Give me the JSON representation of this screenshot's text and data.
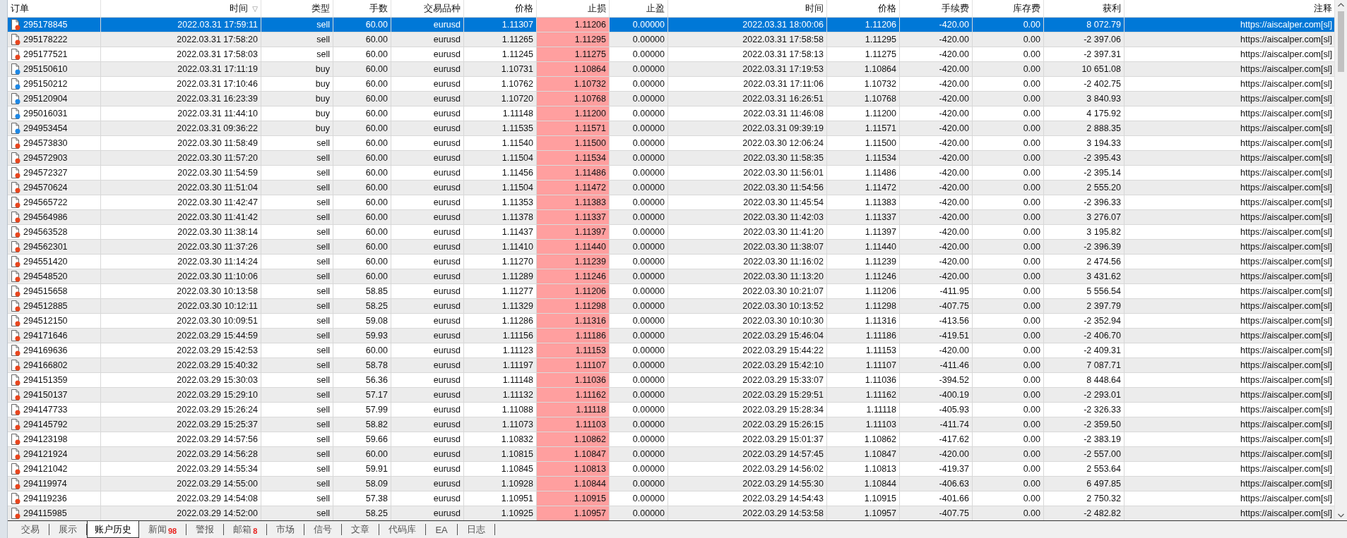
{
  "table": {
    "columns": [
      {
        "label": "订单"
      },
      {
        "label": "时间",
        "sort": "▽"
      },
      {
        "label": "类型"
      },
      {
        "label": "手数"
      },
      {
        "label": "交易品种"
      },
      {
        "label": "价格"
      },
      {
        "label": "止损"
      },
      {
        "label": "止盈"
      },
      {
        "label": "时间"
      },
      {
        "label": "价格"
      },
      {
        "label": "手续费"
      },
      {
        "label": "库存费"
      },
      {
        "label": "获利"
      },
      {
        "label": "注释"
      }
    ],
    "rows": [
      {
        "kind": "sell",
        "selected": true,
        "cells": [
          "295178845",
          "2022.03.31 17:59:11",
          "sell",
          "60.00",
          "eurusd",
          "1.11307",
          "1.11206",
          "0.00000",
          "2022.03.31 18:00:06",
          "1.11206",
          "-420.00",
          "0.00",
          "8 072.79",
          "https://aiscalper.com[sl]"
        ]
      },
      {
        "kind": "sell",
        "selected": false,
        "cells": [
          "295178222",
          "2022.03.31 17:58:20",
          "sell",
          "60.00",
          "eurusd",
          "1.11265",
          "1.11295",
          "0.00000",
          "2022.03.31 17:58:58",
          "1.11295",
          "-420.00",
          "0.00",
          "-2 397.06",
          "https://aiscalper.com[sl]"
        ]
      },
      {
        "kind": "sell",
        "selected": false,
        "cells": [
          "295177521",
          "2022.03.31 17:58:03",
          "sell",
          "60.00",
          "eurusd",
          "1.11245",
          "1.11275",
          "0.00000",
          "2022.03.31 17:58:13",
          "1.11275",
          "-420.00",
          "0.00",
          "-2 397.31",
          "https://aiscalper.com[sl]"
        ]
      },
      {
        "kind": "buy",
        "selected": false,
        "cells": [
          "295150610",
          "2022.03.31 17:11:19",
          "buy",
          "60.00",
          "eurusd",
          "1.10731",
          "1.10864",
          "0.00000",
          "2022.03.31 17:19:53",
          "1.10864",
          "-420.00",
          "0.00",
          "10 651.08",
          "https://aiscalper.com[sl]"
        ]
      },
      {
        "kind": "buy",
        "selected": false,
        "cells": [
          "295150212",
          "2022.03.31 17:10:46",
          "buy",
          "60.00",
          "eurusd",
          "1.10762",
          "1.10732",
          "0.00000",
          "2022.03.31 17:11:06",
          "1.10732",
          "-420.00",
          "0.00",
          "-2 402.75",
          "https://aiscalper.com[sl]"
        ]
      },
      {
        "kind": "buy",
        "selected": false,
        "cells": [
          "295120904",
          "2022.03.31 16:23:39",
          "buy",
          "60.00",
          "eurusd",
          "1.10720",
          "1.10768",
          "0.00000",
          "2022.03.31 16:26:51",
          "1.10768",
          "-420.00",
          "0.00",
          "3 840.93",
          "https://aiscalper.com[sl]"
        ]
      },
      {
        "kind": "buy",
        "selected": false,
        "cells": [
          "295016031",
          "2022.03.31 11:44:10",
          "buy",
          "60.00",
          "eurusd",
          "1.11148",
          "1.11200",
          "0.00000",
          "2022.03.31 11:46:08",
          "1.11200",
          "-420.00",
          "0.00",
          "4 175.92",
          "https://aiscalper.com[sl]"
        ]
      },
      {
        "kind": "buy",
        "selected": false,
        "cells": [
          "294953454",
          "2022.03.31 09:36:22",
          "buy",
          "60.00",
          "eurusd",
          "1.11535",
          "1.11571",
          "0.00000",
          "2022.03.31 09:39:19",
          "1.11571",
          "-420.00",
          "0.00",
          "2 888.35",
          "https://aiscalper.com[sl]"
        ]
      },
      {
        "kind": "sell",
        "selected": false,
        "cells": [
          "294573830",
          "2022.03.30 11:58:49",
          "sell",
          "60.00",
          "eurusd",
          "1.11540",
          "1.11500",
          "0.00000",
          "2022.03.30 12:06:24",
          "1.11500",
          "-420.00",
          "0.00",
          "3 194.33",
          "https://aiscalper.com[sl]"
        ]
      },
      {
        "kind": "sell",
        "selected": false,
        "cells": [
          "294572903",
          "2022.03.30 11:57:20",
          "sell",
          "60.00",
          "eurusd",
          "1.11504",
          "1.11534",
          "0.00000",
          "2022.03.30 11:58:35",
          "1.11534",
          "-420.00",
          "0.00",
          "-2 395.43",
          "https://aiscalper.com[sl]"
        ]
      },
      {
        "kind": "sell",
        "selected": false,
        "cells": [
          "294572327",
          "2022.03.30 11:54:59",
          "sell",
          "60.00",
          "eurusd",
          "1.11456",
          "1.11486",
          "0.00000",
          "2022.03.30 11:56:01",
          "1.11486",
          "-420.00",
          "0.00",
          "-2 395.14",
          "https://aiscalper.com[sl]"
        ]
      },
      {
        "kind": "sell",
        "selected": false,
        "cells": [
          "294570624",
          "2022.03.30 11:51:04",
          "sell",
          "60.00",
          "eurusd",
          "1.11504",
          "1.11472",
          "0.00000",
          "2022.03.30 11:54:56",
          "1.11472",
          "-420.00",
          "0.00",
          "2 555.20",
          "https://aiscalper.com[sl]"
        ]
      },
      {
        "kind": "sell",
        "selected": false,
        "cells": [
          "294565722",
          "2022.03.30 11:42:47",
          "sell",
          "60.00",
          "eurusd",
          "1.11353",
          "1.11383",
          "0.00000",
          "2022.03.30 11:45:54",
          "1.11383",
          "-420.00",
          "0.00",
          "-2 396.33",
          "https://aiscalper.com[sl]"
        ]
      },
      {
        "kind": "sell",
        "selected": false,
        "cells": [
          "294564986",
          "2022.03.30 11:41:42",
          "sell",
          "60.00",
          "eurusd",
          "1.11378",
          "1.11337",
          "0.00000",
          "2022.03.30 11:42:03",
          "1.11337",
          "-420.00",
          "0.00",
          "3 276.07",
          "https://aiscalper.com[sl]"
        ]
      },
      {
        "kind": "sell",
        "selected": false,
        "cells": [
          "294563528",
          "2022.03.30 11:38:14",
          "sell",
          "60.00",
          "eurusd",
          "1.11437",
          "1.11397",
          "0.00000",
          "2022.03.30 11:41:20",
          "1.11397",
          "-420.00",
          "0.00",
          "3 195.82",
          "https://aiscalper.com[sl]"
        ]
      },
      {
        "kind": "sell",
        "selected": false,
        "cells": [
          "294562301",
          "2022.03.30 11:37:26",
          "sell",
          "60.00",
          "eurusd",
          "1.11410",
          "1.11440",
          "0.00000",
          "2022.03.30 11:38:07",
          "1.11440",
          "-420.00",
          "0.00",
          "-2 396.39",
          "https://aiscalper.com[sl]"
        ]
      },
      {
        "kind": "sell",
        "selected": false,
        "cells": [
          "294551420",
          "2022.03.30 11:14:24",
          "sell",
          "60.00",
          "eurusd",
          "1.11270",
          "1.11239",
          "0.00000",
          "2022.03.30 11:16:02",
          "1.11239",
          "-420.00",
          "0.00",
          "2 474.56",
          "https://aiscalper.com[sl]"
        ]
      },
      {
        "kind": "sell",
        "selected": false,
        "cells": [
          "294548520",
          "2022.03.30 11:10:06",
          "sell",
          "60.00",
          "eurusd",
          "1.11289",
          "1.11246",
          "0.00000",
          "2022.03.30 11:13:20",
          "1.11246",
          "-420.00",
          "0.00",
          "3 431.62",
          "https://aiscalper.com[sl]"
        ]
      },
      {
        "kind": "sell",
        "selected": false,
        "cells": [
          "294515658",
          "2022.03.30 10:13:58",
          "sell",
          "58.85",
          "eurusd",
          "1.11277",
          "1.11206",
          "0.00000",
          "2022.03.30 10:21:07",
          "1.11206",
          "-411.95",
          "0.00",
          "5 556.54",
          "https://aiscalper.com[sl]"
        ]
      },
      {
        "kind": "sell",
        "selected": false,
        "cells": [
          "294512885",
          "2022.03.30 10:12:11",
          "sell",
          "58.25",
          "eurusd",
          "1.11329",
          "1.11298",
          "0.00000",
          "2022.03.30 10:13:52",
          "1.11298",
          "-407.75",
          "0.00",
          "2 397.79",
          "https://aiscalper.com[sl]"
        ]
      },
      {
        "kind": "sell",
        "selected": false,
        "cells": [
          "294512150",
          "2022.03.30 10:09:51",
          "sell",
          "59.08",
          "eurusd",
          "1.11286",
          "1.11316",
          "0.00000",
          "2022.03.30 10:10:30",
          "1.11316",
          "-413.56",
          "0.00",
          "-2 352.94",
          "https://aiscalper.com[sl]"
        ]
      },
      {
        "kind": "sell",
        "selected": false,
        "cells": [
          "294171646",
          "2022.03.29 15:44:59",
          "sell",
          "59.93",
          "eurusd",
          "1.11156",
          "1.11186",
          "0.00000",
          "2022.03.29 15:46:04",
          "1.11186",
          "-419.51",
          "0.00",
          "-2 406.70",
          "https://aiscalper.com[sl]"
        ]
      },
      {
        "kind": "sell",
        "selected": false,
        "cells": [
          "294169636",
          "2022.03.29 15:42:53",
          "sell",
          "60.00",
          "eurusd",
          "1.11123",
          "1.11153",
          "0.00000",
          "2022.03.29 15:44:22",
          "1.11153",
          "-420.00",
          "0.00",
          "-2 409.31",
          "https://aiscalper.com[sl]"
        ]
      },
      {
        "kind": "sell",
        "selected": false,
        "cells": [
          "294166802",
          "2022.03.29 15:40:32",
          "sell",
          "58.78",
          "eurusd",
          "1.11197",
          "1.11107",
          "0.00000",
          "2022.03.29 15:42:10",
          "1.11107",
          "-411.46",
          "0.00",
          "7 087.71",
          "https://aiscalper.com[sl]"
        ]
      },
      {
        "kind": "sell",
        "selected": false,
        "cells": [
          "294151359",
          "2022.03.29 15:30:03",
          "sell",
          "56.36",
          "eurusd",
          "1.11148",
          "1.11036",
          "0.00000",
          "2022.03.29 15:33:07",
          "1.11036",
          "-394.52",
          "0.00",
          "8 448.64",
          "https://aiscalper.com[sl]"
        ]
      },
      {
        "kind": "sell",
        "selected": false,
        "cells": [
          "294150137",
          "2022.03.29 15:29:10",
          "sell",
          "57.17",
          "eurusd",
          "1.11132",
          "1.11162",
          "0.00000",
          "2022.03.29 15:29:51",
          "1.11162",
          "-400.19",
          "0.00",
          "-2 293.01",
          "https://aiscalper.com[sl]"
        ]
      },
      {
        "kind": "sell",
        "selected": false,
        "cells": [
          "294147733",
          "2022.03.29 15:26:24",
          "sell",
          "57.99",
          "eurusd",
          "1.11088",
          "1.11118",
          "0.00000",
          "2022.03.29 15:28:34",
          "1.11118",
          "-405.93",
          "0.00",
          "-2 326.33",
          "https://aiscalper.com[sl]"
        ]
      },
      {
        "kind": "sell",
        "selected": false,
        "cells": [
          "294145792",
          "2022.03.29 15:25:37",
          "sell",
          "58.82",
          "eurusd",
          "1.11073",
          "1.11103",
          "0.00000",
          "2022.03.29 15:26:15",
          "1.11103",
          "-411.74",
          "0.00",
          "-2 359.50",
          "https://aiscalper.com[sl]"
        ]
      },
      {
        "kind": "sell",
        "selected": false,
        "cells": [
          "294123198",
          "2022.03.29 14:57:56",
          "sell",
          "59.66",
          "eurusd",
          "1.10832",
          "1.10862",
          "0.00000",
          "2022.03.29 15:01:37",
          "1.10862",
          "-417.62",
          "0.00",
          "-2 383.19",
          "https://aiscalper.com[sl]"
        ]
      },
      {
        "kind": "sell",
        "selected": false,
        "cells": [
          "294121924",
          "2022.03.29 14:56:28",
          "sell",
          "60.00",
          "eurusd",
          "1.10815",
          "1.10847",
          "0.00000",
          "2022.03.29 14:57:45",
          "1.10847",
          "-420.00",
          "0.00",
          "-2 557.00",
          "https://aiscalper.com[sl]"
        ]
      },
      {
        "kind": "sell",
        "selected": false,
        "cells": [
          "294121042",
          "2022.03.29 14:55:34",
          "sell",
          "59.91",
          "eurusd",
          "1.10845",
          "1.10813",
          "0.00000",
          "2022.03.29 14:56:02",
          "1.10813",
          "-419.37",
          "0.00",
          "2 553.64",
          "https://aiscalper.com[sl]"
        ]
      },
      {
        "kind": "sell",
        "selected": false,
        "cells": [
          "294119974",
          "2022.03.29 14:55:00",
          "sell",
          "58.09",
          "eurusd",
          "1.10928",
          "1.10844",
          "0.00000",
          "2022.03.29 14:55:30",
          "1.10844",
          "-406.63",
          "0.00",
          "6 497.85",
          "https://aiscalper.com[sl]"
        ]
      },
      {
        "kind": "sell",
        "selected": false,
        "cells": [
          "294119236",
          "2022.03.29 14:54:08",
          "sell",
          "57.38",
          "eurusd",
          "1.10951",
          "1.10915",
          "0.00000",
          "2022.03.29 14:54:43",
          "1.10915",
          "-401.66",
          "0.00",
          "2 750.32",
          "https://aiscalper.com[sl]"
        ]
      },
      {
        "kind": "sell",
        "selected": false,
        "cells": [
          "294115985",
          "2022.03.29 14:52:00",
          "sell",
          "58.25",
          "eurusd",
          "1.10925",
          "1.10957",
          "0.00000",
          "2022.03.29 14:53:58",
          "1.10957",
          "-407.75",
          "0.00",
          "-2 482.82",
          "https://aiscalper.com[sl]"
        ]
      }
    ]
  },
  "tabs": [
    {
      "label": "交易",
      "selected": false
    },
    {
      "label": "展示",
      "selected": false
    },
    {
      "label": "账户历史",
      "selected": true
    },
    {
      "label": "新闻",
      "badge": "98",
      "selected": false
    },
    {
      "label": "警报",
      "selected": false
    },
    {
      "label": "邮箱",
      "badge": "8",
      "selected": false
    },
    {
      "label": "市场",
      "selected": false
    },
    {
      "label": "信号",
      "selected": false
    },
    {
      "label": "文章",
      "selected": false
    },
    {
      "label": "代码库",
      "selected": false
    },
    {
      "label": "EA",
      "selected": false
    },
    {
      "label": "日志",
      "selected": false
    }
  ]
}
